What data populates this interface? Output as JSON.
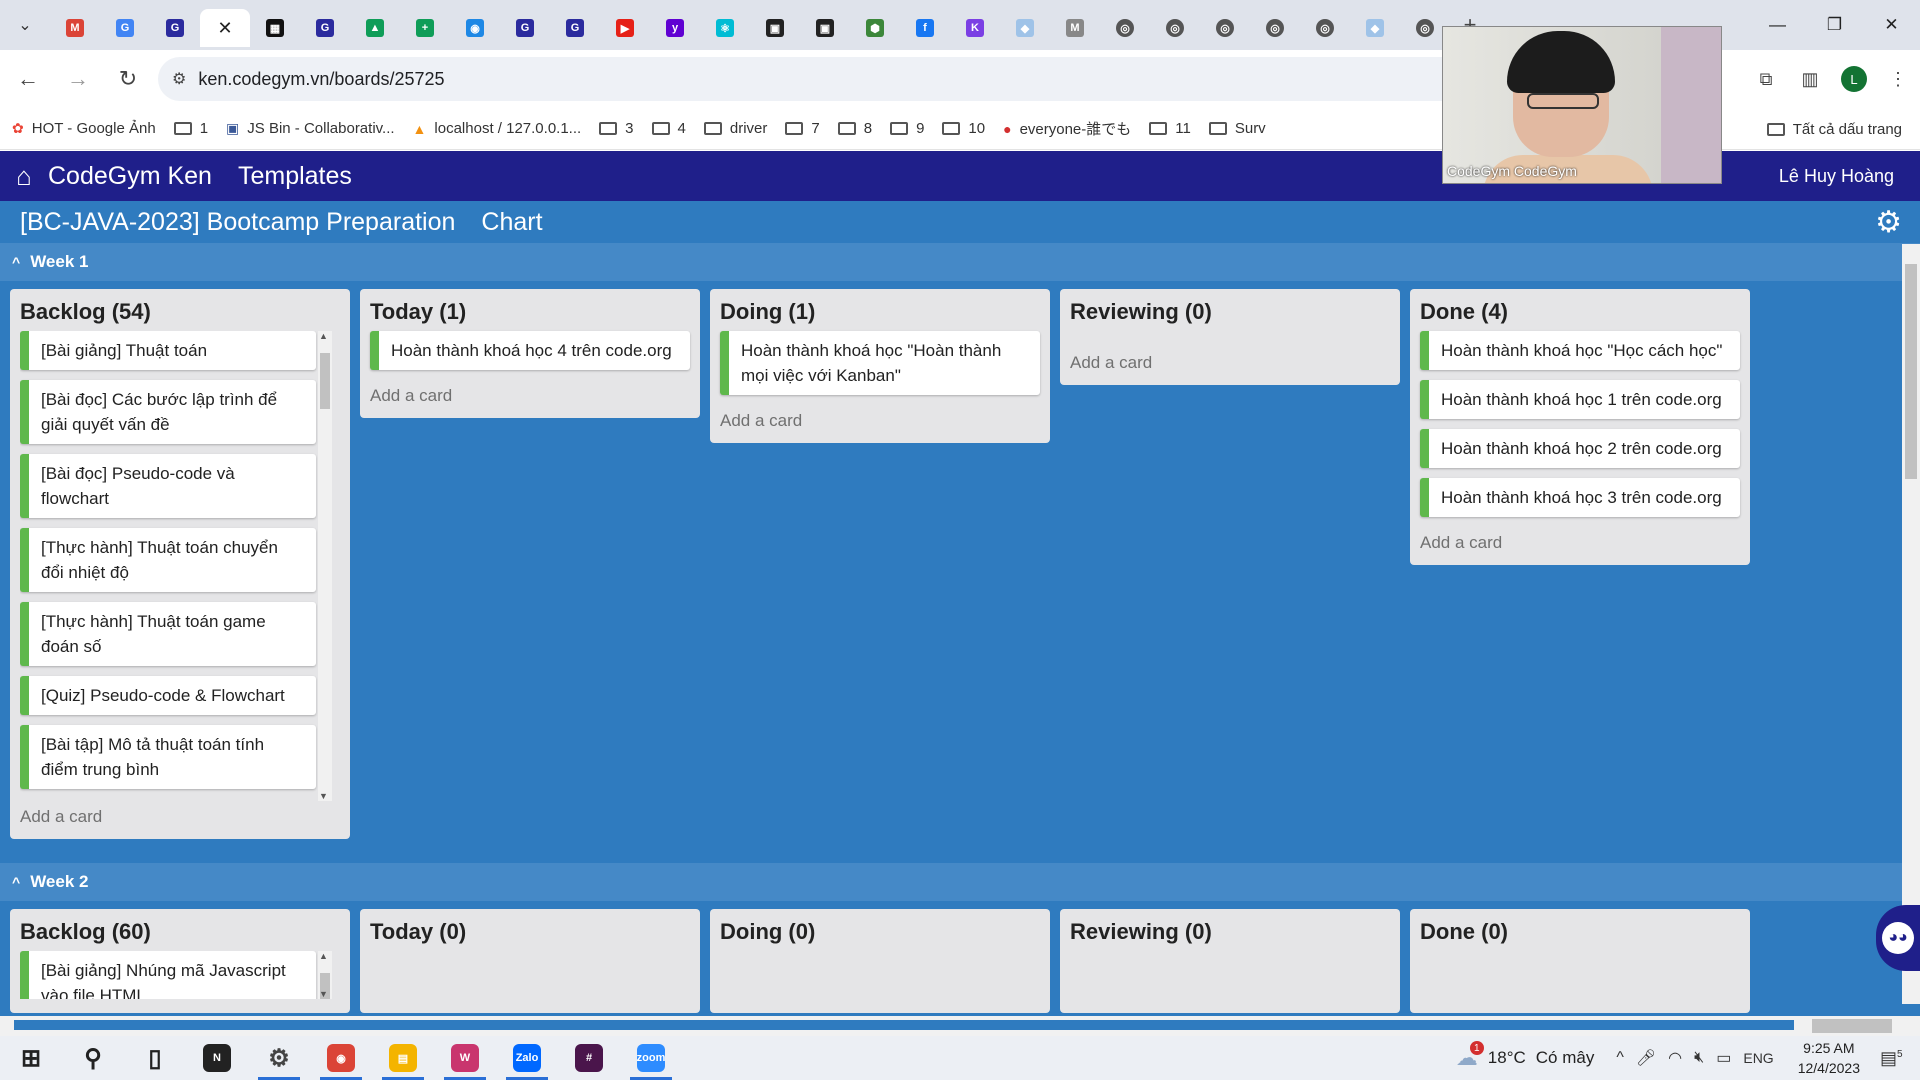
{
  "browser": {
    "url": "ken.codegym.vn/boards/25725",
    "tabs": [
      {
        "icon": "gmail",
        "color": "#db4437",
        "glyph": "M"
      },
      {
        "icon": "translate",
        "color": "#4285f4",
        "glyph": "G"
      },
      {
        "icon": "codegym",
        "color": "#2b2b9e",
        "glyph": "G"
      },
      {
        "icon": "codegym-active",
        "color": "#000",
        "glyph": "✕",
        "active": true
      },
      {
        "icon": "qr",
        "color": "#111",
        "glyph": "▦"
      },
      {
        "icon": "codegym",
        "color": "#2b2b9e",
        "glyph": "G"
      },
      {
        "icon": "drive",
        "color": "#0f9d58",
        "glyph": "▲"
      },
      {
        "icon": "sheets",
        "color": "#0f9d58",
        "glyph": "+"
      },
      {
        "icon": "meet",
        "color": "#1e88e5",
        "glyph": "◉"
      },
      {
        "icon": "codegym",
        "color": "#2b2b9e",
        "glyph": "G"
      },
      {
        "icon": "codegym",
        "color": "#2b2b9e",
        "glyph": "G"
      },
      {
        "icon": "youtube",
        "color": "#e62117",
        "glyph": "▶"
      },
      {
        "icon": "yahoo",
        "color": "#6001d2",
        "glyph": "y"
      },
      {
        "icon": "react",
        "color": "#00bcd4",
        "glyph": "⚛"
      },
      {
        "icon": "terminal",
        "color": "#222",
        "glyph": "▣"
      },
      {
        "icon": "terminal",
        "color": "#222",
        "glyph": "▣"
      },
      {
        "icon": "node",
        "color": "#3c873a",
        "glyph": "⬢"
      },
      {
        "icon": "facebook",
        "color": "#1877f2",
        "glyph": "f"
      },
      {
        "icon": "k",
        "color": "#7b3fe4",
        "glyph": "K"
      },
      {
        "icon": "diamond",
        "color": "#9fc3e8",
        "glyph": "◆"
      },
      {
        "icon": "m",
        "color": "#888",
        "glyph": "M"
      },
      {
        "icon": "globe",
        "color": "#555",
        "glyph": "◎"
      },
      {
        "icon": "globe",
        "color": "#555",
        "glyph": "◎"
      },
      {
        "icon": "globe",
        "color": "#555",
        "glyph": "◎"
      },
      {
        "icon": "globe",
        "color": "#555",
        "glyph": "◎"
      },
      {
        "icon": "globe",
        "color": "#555",
        "glyph": "◎"
      },
      {
        "icon": "diamond",
        "color": "#9fc3e8",
        "glyph": "◆"
      },
      {
        "icon": "globe",
        "color": "#555",
        "glyph": "◎"
      }
    ],
    "bookmarks": [
      {
        "label": "HOT - Google Ảnh",
        "icon": "photos"
      },
      {
        "label": "1",
        "icon": "folder"
      },
      {
        "label": "JS Bin - Collaborativ...",
        "icon": "jsbin"
      },
      {
        "label": "localhost / 127.0.0.1...",
        "icon": "pma"
      },
      {
        "label": "3",
        "icon": "folder"
      },
      {
        "label": "4",
        "icon": "folder"
      },
      {
        "label": "driver",
        "icon": "folder"
      },
      {
        "label": "7",
        "icon": "folder"
      },
      {
        "label": "8",
        "icon": "folder"
      },
      {
        "label": "9",
        "icon": "folder"
      },
      {
        "label": "10",
        "icon": "folder"
      },
      {
        "label": "everyone-誰でも",
        "icon": "badge"
      },
      {
        "label": "11",
        "icon": "folder"
      },
      {
        "label": "Surv",
        "icon": "folder"
      }
    ],
    "bookmarks_all": "Tất cả dấu trang",
    "profile_initial": "L"
  },
  "webcam": {
    "label": "CodeGym CodeGym"
  },
  "app": {
    "brand": "CodeGym Ken",
    "templates": "Templates",
    "user": "Lê Huy Hoàng",
    "board_title": "[BC-JAVA-2023] Bootcamp Preparation",
    "chart": "Chart"
  },
  "weeks": [
    {
      "title": "Week 1",
      "lanes": [
        {
          "title": "Backlog (54)",
          "add": "Add a card",
          "cards": [
            "[Bài giảng] Thuật toán",
            "[Bài đọc] Các bước lập trình để giải quyết vấn đề",
            "[Bài đọc] Pseudo-code và flowchart",
            "[Thực hành] Thuật toán chuyển đổi nhiệt độ",
            "[Thực hành] Thuật toán game đoán số",
            "[Quiz] Pseudo-code & Flowchart",
            "[Bài tập] Mô tả thuật toán tính điểm trung bình"
          ]
        },
        {
          "title": "Today (1)",
          "add": "Add a card",
          "cards": [
            "Hoàn thành khoá học 4 trên code.org"
          ]
        },
        {
          "title": "Doing (1)",
          "add": "Add a card",
          "cards": [
            "Hoàn thành khoá học \"Hoàn thành mọi việc với Kanban\""
          ]
        },
        {
          "title": "Reviewing (0)",
          "add": "Add a card",
          "cards": []
        },
        {
          "title": "Done (4)",
          "add": "Add a card",
          "cards": [
            "Hoàn thành khoá học \"Học cách học\"",
            "Hoàn thành khoá học 1 trên code.org",
            "Hoàn thành khoá học 2 trên code.org",
            "Hoàn thành khoá học 3 trên code.org"
          ]
        }
      ]
    },
    {
      "title": "Week 2",
      "lanes": [
        {
          "title": "Backlog (60)",
          "cards": [
            "[Bài giảng] Nhúng mã Javascript vào file HTML"
          ]
        },
        {
          "title": "Today (0)",
          "cards": []
        },
        {
          "title": "Doing (0)",
          "cards": []
        },
        {
          "title": "Reviewing (0)",
          "cards": []
        },
        {
          "title": "Done (0)",
          "cards": []
        }
      ]
    }
  ],
  "taskbar": {
    "apps": [
      {
        "name": "start",
        "glyph": "⊞",
        "color": "#222"
      },
      {
        "name": "search",
        "glyph": "⚲",
        "color": "#222"
      },
      {
        "name": "task-view",
        "glyph": "▯",
        "color": "#222"
      },
      {
        "name": "notion",
        "glyph": "N",
        "color": "#222"
      },
      {
        "name": "settings",
        "glyph": "⚙",
        "color": "#444",
        "open": true
      },
      {
        "name": "chrome",
        "glyph": "◉",
        "color": "#db4437",
        "open": true
      },
      {
        "name": "explorer",
        "glyph": "▤",
        "color": "#f4b400",
        "open": true
      },
      {
        "name": "wps",
        "glyph": "W",
        "color": "#c9356e",
        "open": true
      },
      {
        "name": "zalo",
        "glyph": "Zalo",
        "color": "#0068ff",
        "open": true
      },
      {
        "name": "slack",
        "glyph": "#",
        "color": "#4a154b"
      },
      {
        "name": "zoom",
        "glyph": "zoom",
        "color": "#2d8cff",
        "open": true
      }
    ],
    "weather_temp": "18°C",
    "weather_desc": "Có mây",
    "weather_badge": "1",
    "lang": "ENG",
    "time": "9:25 AM",
    "date": "12/4/2023",
    "notif_count": "5"
  }
}
